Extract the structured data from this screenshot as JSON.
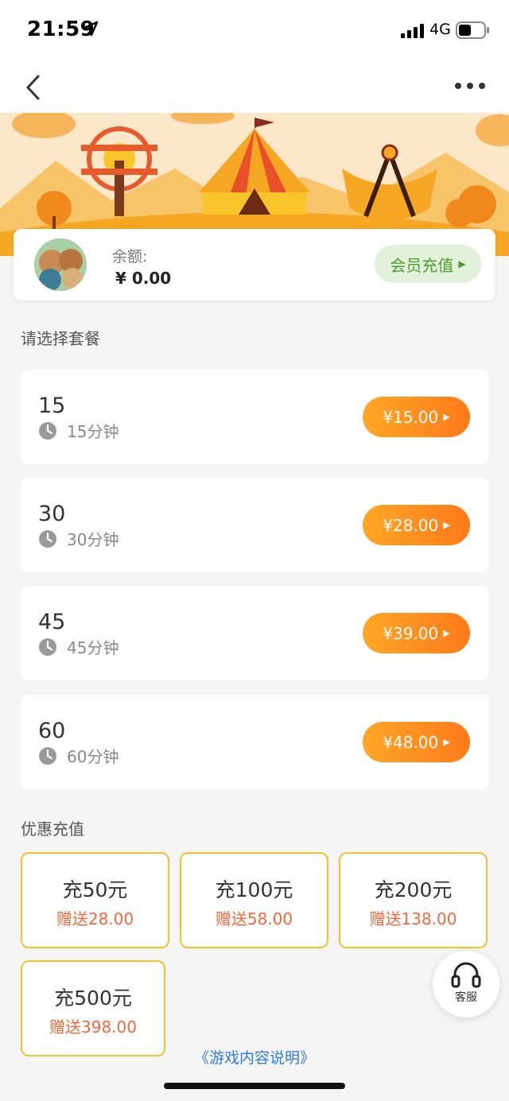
{
  "status_bar": {
    "time": "21:59",
    "network": "4G"
  },
  "account": {
    "balance_label": "余额:",
    "balance_value": "¥ 0.00",
    "vip_recharge_label": "会员充值"
  },
  "packages_section_title": "请选择套餐",
  "packages": [
    {
      "name": "15",
      "duration": "15分钟",
      "price": "¥15.00"
    },
    {
      "name": "30",
      "duration": "30分钟",
      "price": "¥28.00"
    },
    {
      "name": "45",
      "duration": "45分钟",
      "price": "¥39.00"
    },
    {
      "name": "60",
      "duration": "60分钟",
      "price": "¥48.00"
    }
  ],
  "offers_section_title": "优惠充值",
  "offers": [
    {
      "amount": "充50元",
      "bonus": "赠送28.00"
    },
    {
      "amount": "充100元",
      "bonus": "赠送58.00"
    },
    {
      "amount": "充200元",
      "bonus": "赠送138.00"
    },
    {
      "amount": "充500元",
      "bonus": "赠送398.00"
    }
  ],
  "customer_service_label": "客服",
  "game_description_link": "《游戏内容说明》",
  "colors": {
    "accent_orange": "#ff8a1f",
    "offer_border": "#f2c12e",
    "bonus_text": "#f0693a",
    "vip_green": "#4a9e2a",
    "link_blue": "#2d7be0"
  },
  "icons": [
    "location-arrow-icon",
    "signal-icon",
    "battery-icon",
    "back-chevron-icon",
    "more-icon",
    "clock-icon",
    "headset-icon"
  ]
}
